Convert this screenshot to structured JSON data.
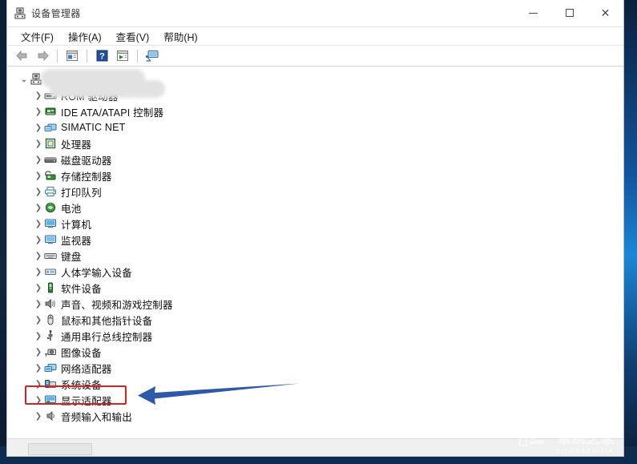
{
  "window": {
    "title": "设备管理器",
    "title_icon": "device-manager-icon",
    "controls": {
      "minimize": "—",
      "maximize": "□",
      "close": "✕"
    }
  },
  "menubar": {
    "items": [
      {
        "label": "文件(F)",
        "name": "menu-file"
      },
      {
        "label": "操作(A)",
        "name": "menu-action"
      },
      {
        "label": "查看(V)",
        "name": "menu-view"
      },
      {
        "label": "帮助(H)",
        "name": "menu-help"
      }
    ]
  },
  "toolbar": {
    "items": [
      {
        "name": "back-arrow-icon",
        "glyph": "←",
        "enabled": false
      },
      {
        "name": "forward-arrow-icon",
        "glyph": "→",
        "enabled": false
      },
      {
        "name": "separator-1",
        "glyph": "",
        "enabled": false
      },
      {
        "name": "properties-icon",
        "glyph": "",
        "enabled": true
      },
      {
        "name": "separator-2",
        "glyph": "",
        "enabled": false
      },
      {
        "name": "help-icon",
        "glyph": "?",
        "enabled": true
      },
      {
        "name": "update-driver-icon",
        "glyph": "",
        "enabled": true
      },
      {
        "name": "separator-3",
        "glyph": "",
        "enabled": false
      },
      {
        "name": "scan-hardware-changes-icon",
        "glyph": "",
        "enabled": true
      }
    ]
  },
  "tree": {
    "root": {
      "label": "",
      "redacted": true,
      "icon": "computer-root-icon",
      "expanded": true
    },
    "items": [
      {
        "label": "ROM 驱动器",
        "icon": "dvd-drive-icon",
        "redacted_prefix": true
      },
      {
        "label": "IDE ATA/ATAPI 控制器",
        "icon": "ide-controller-icon"
      },
      {
        "label": "SIMATIC NET",
        "icon": "network-node-icon"
      },
      {
        "label": "处理器",
        "icon": "processor-icon"
      },
      {
        "label": "磁盘驱动器",
        "icon": "disk-drive-icon"
      },
      {
        "label": "存储控制器",
        "icon": "storage-controller-icon"
      },
      {
        "label": "打印队列",
        "icon": "printer-icon"
      },
      {
        "label": "电池",
        "icon": "battery-icon"
      },
      {
        "label": "计算机",
        "icon": "computer-icon"
      },
      {
        "label": "监视器",
        "icon": "monitor-icon"
      },
      {
        "label": "键盘",
        "icon": "keyboard-icon"
      },
      {
        "label": "人体学输入设备",
        "icon": "hid-icon"
      },
      {
        "label": "软件设备",
        "icon": "software-device-icon"
      },
      {
        "label": "声音、视频和游戏控制器",
        "icon": "sound-video-game-icon"
      },
      {
        "label": "鼠标和其他指针设备",
        "icon": "mouse-icon"
      },
      {
        "label": "通用串行总线控制器",
        "icon": "usb-controller-icon"
      },
      {
        "label": "图像设备",
        "icon": "imaging-device-icon"
      },
      {
        "label": "网络适配器",
        "icon": "network-adapter-icon"
      },
      {
        "label": "系统设备",
        "icon": "system-device-icon"
      },
      {
        "label": "显示适配器",
        "icon": "display-adapter-icon",
        "highlighted": true
      },
      {
        "label": "音频输入和输出",
        "icon": "audio-io-icon"
      }
    ],
    "chevron_collapsed": "❯",
    "chevron_expanded": "⌄"
  },
  "annotations": {
    "highlight_color": "#e02020",
    "arrow_color": "#2d5aa8",
    "highlight_target": "显示适配器"
  },
  "watermark": {
    "text": "系统之家",
    "subtext": "XITONGZHIJIA"
  },
  "statusbar": {
    "text": ""
  }
}
